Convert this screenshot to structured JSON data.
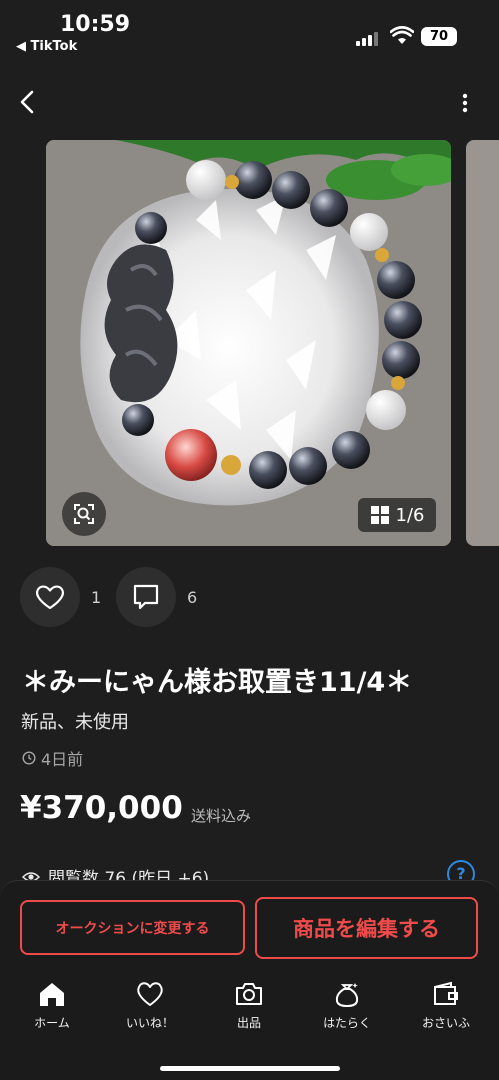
{
  "status_bar": {
    "time": "10:59",
    "back_app": "◀ TikTok",
    "battery": "70"
  },
  "gallery": {
    "counter": "1/6"
  },
  "actions": {
    "likes": "1",
    "comments": "6"
  },
  "item": {
    "title": "＊みーにゃん様お取置き11/4＊",
    "condition": "新品、未使用",
    "posted": "4日前",
    "price": "¥370,000",
    "price_note": "送料込み",
    "views": "閲覧数  76 (昨日 +6)"
  },
  "buttons": {
    "auction": "オークションに変更する",
    "edit": "商品を編集する"
  },
  "tabbar": [
    {
      "label": "ホーム",
      "icon": "home-icon"
    },
    {
      "label": "いいね！",
      "icon": "heart-icon"
    },
    {
      "label": "出品",
      "icon": "camera-icon"
    },
    {
      "label": "はたらく",
      "icon": "money-bag-icon"
    },
    {
      "label": "おさいふ",
      "icon": "wallet-icon"
    }
  ],
  "colors": {
    "accent": "#ef4b4b",
    "link": "#2d88e0",
    "background": "#1e1e1e"
  }
}
